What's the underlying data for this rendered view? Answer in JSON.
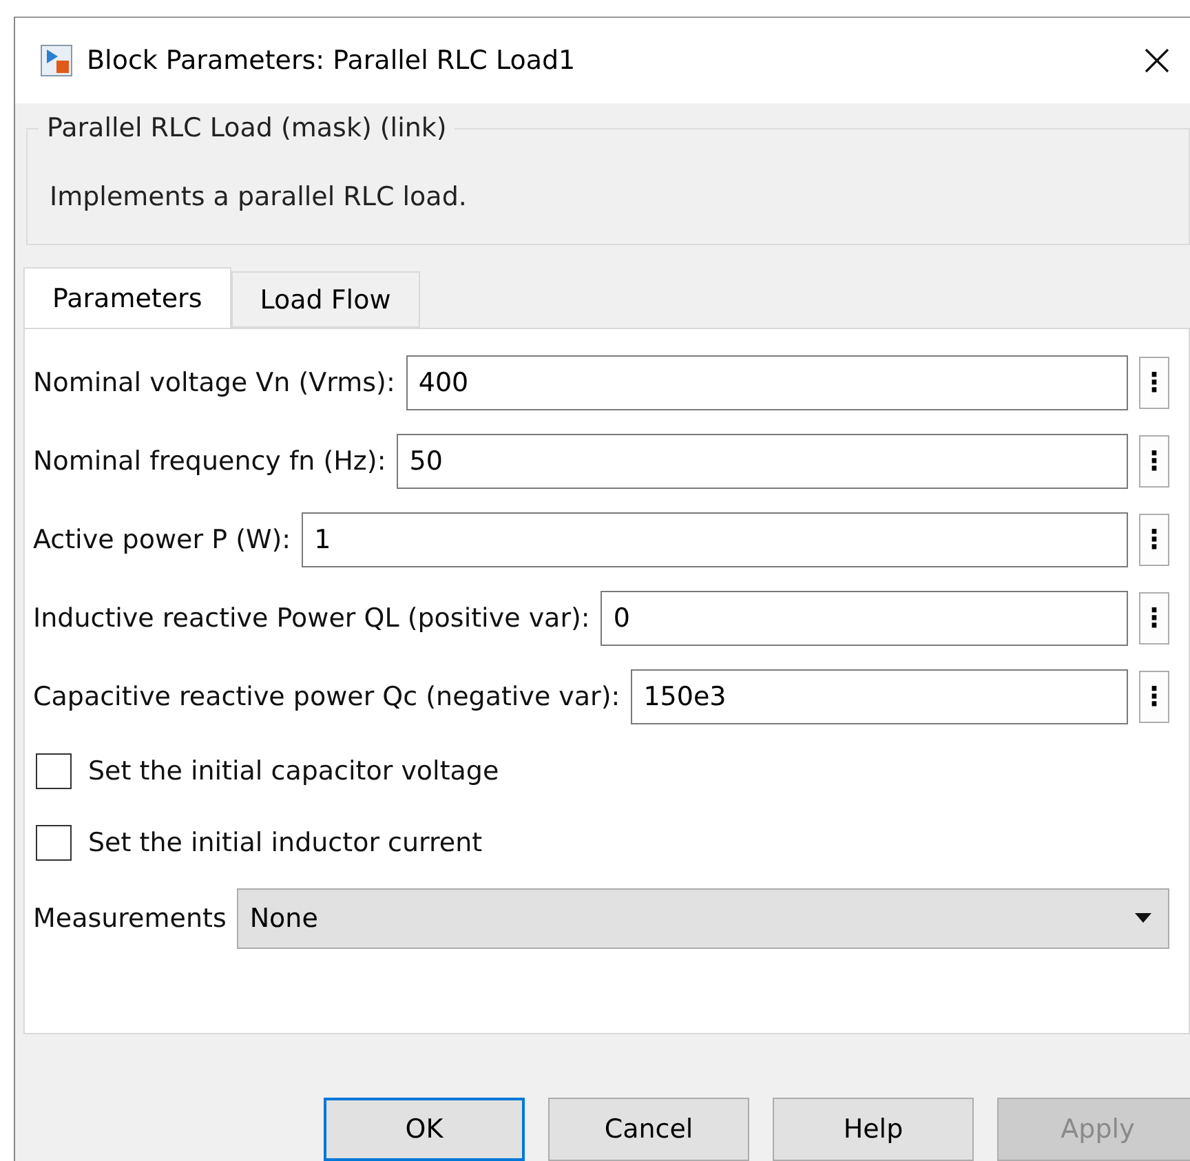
{
  "window": {
    "title": "Block Parameters: Parallel RLC Load1"
  },
  "mask": {
    "title": "Parallel RLC Load (mask) (link)",
    "description": "Implements a parallel RLC load."
  },
  "tabs": [
    {
      "label": "Parameters",
      "selected": true
    },
    {
      "label": "Load Flow",
      "selected": false
    }
  ],
  "fields": [
    {
      "label": "Nominal voltage Vn (Vrms):",
      "value": "400",
      "menu": "⋮"
    },
    {
      "label": "Nominal frequency fn (Hz):",
      "value": "50",
      "menu": "⋮"
    },
    {
      "label": "Active power P (W):",
      "value": "1",
      "menu": "⋮"
    },
    {
      "label": "Inductive reactive Power QL (positive var):",
      "value": "0",
      "menu": "⋮"
    },
    {
      "label": "Capacitive reactive power Qc (negative var):",
      "value": "150e3",
      "menu": "⋮"
    }
  ],
  "checkboxes": [
    {
      "label": "Set the initial capacitor voltage",
      "checked": false
    },
    {
      "label": "Set the initial inductor current",
      "checked": false
    }
  ],
  "measurements": {
    "label": "Measurements",
    "value": "None"
  },
  "buttons": [
    {
      "label": "OK",
      "disabled": false,
      "selected": true
    },
    {
      "label": "Cancel",
      "disabled": false,
      "selected": false
    },
    {
      "label": "Help",
      "disabled": false,
      "selected": false
    },
    {
      "label": "Apply",
      "disabled": true,
      "selected": false
    }
  ]
}
